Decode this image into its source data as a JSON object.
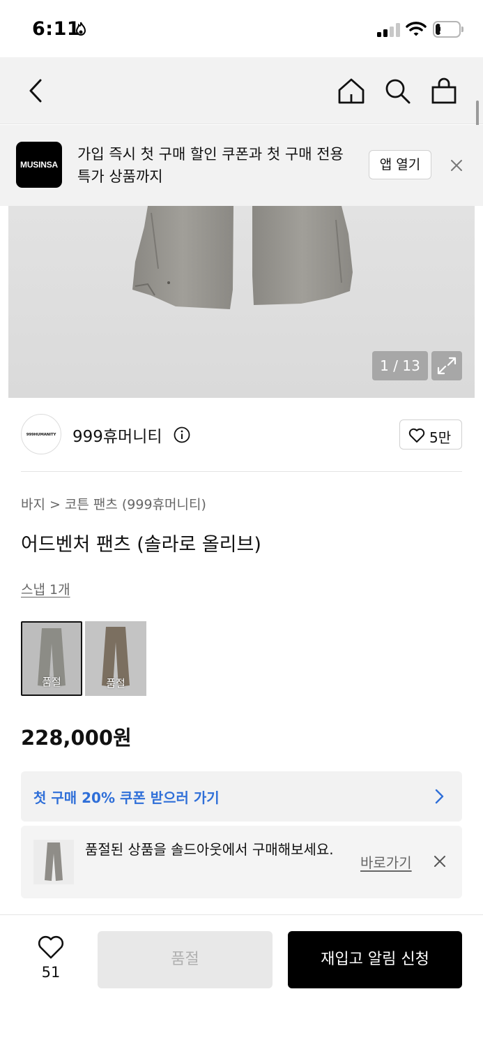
{
  "status_bar": {
    "time": "6:11",
    "battery": "21",
    "battery_level_percent": 21
  },
  "nav": {
    "back_icon": "chevron-left-icon",
    "home_icon": "home-icon",
    "search_icon": "search-icon",
    "cart_icon": "shopping-bag-icon"
  },
  "app_banner": {
    "logo_text": "MUSINSA",
    "message": "가입 즉시 첫 구매 할인 쿠폰과 첫 구매 전용 특가 상품까지",
    "open_app_label": "앱 열기"
  },
  "gallery": {
    "pager": "1 / 13"
  },
  "brand": {
    "logo_text": "999HUMANITY",
    "name": "999휴머니티",
    "like_count": "5만"
  },
  "product": {
    "breadcrumb": [
      "바지",
      "코튼 팬츠 (999휴머니티)"
    ],
    "title": "어드벤처 팬츠 (솔라로 올리브)",
    "snap_link": "스냅 1개",
    "options": [
      {
        "label": "품절",
        "color": "#8c8c86"
      },
      {
        "label": "품절",
        "color": "#7b6f60"
      }
    ],
    "price": "228,000원"
  },
  "coupon": {
    "text": "첫 구매 20% 쿠폰 받으러 가기",
    "color": "#2f6fd8"
  },
  "soldout_notice": {
    "text": "품절된 상품을 솔드아웃에서 구매해보세요.",
    "link": "바로가기"
  },
  "bottom_bar": {
    "wish_count": "51",
    "soldout_label": "품절",
    "restock_label": "재입고 알림 신청"
  }
}
